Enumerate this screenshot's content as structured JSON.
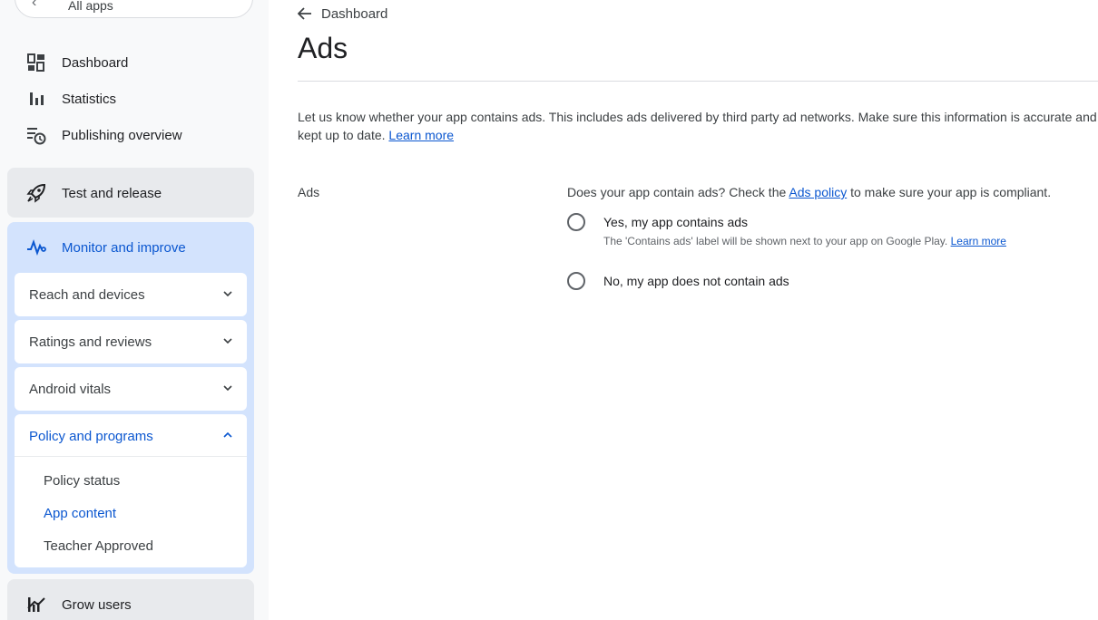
{
  "sidebar": {
    "all_apps_label": "All apps",
    "top_items": [
      {
        "label": "Dashboard",
        "icon": "dashboard-icon"
      },
      {
        "label": "Statistics",
        "icon": "bar-chart-icon"
      },
      {
        "label": "Publishing overview",
        "icon": "publishing-history-icon"
      }
    ],
    "test_release": {
      "label": "Test and release",
      "icon": "rocket-icon"
    },
    "monitor": {
      "label": "Monitor and improve",
      "icon": "monitoring-icon",
      "cards": [
        {
          "label": "Reach and devices"
        },
        {
          "label": "Ratings and reviews"
        },
        {
          "label": "Android vitals"
        },
        {
          "label": "Policy and programs",
          "expanded": true
        }
      ],
      "policy_subitems": [
        {
          "label": "Policy status"
        },
        {
          "label": "App content",
          "active": true
        },
        {
          "label": "Teacher Approved"
        }
      ]
    },
    "grow": {
      "label": "Grow users",
      "icon": "grow-chart-icon"
    }
  },
  "main": {
    "back_label": "Dashboard",
    "title": "Ads",
    "intro_text": "Let us know whether your app contains ads. This includes ads delivered by third party ad networks. Make sure this information is accurate and is kept up to date.",
    "intro_link": "Learn more",
    "field_label": "Ads",
    "question_before": "Does your app contain ads? Check the",
    "question_link": "Ads policy",
    "question_after": "to make sure your app is compliant.",
    "options": [
      {
        "label": "Yes, my app contains ads",
        "help": "The 'Contains ads' label will be shown next to your app on Google Play.",
        "help_link": "Learn more"
      },
      {
        "label": "No, my app does not contain ads"
      }
    ]
  },
  "colors": {
    "accent": "#0b57d0",
    "nav_bg": "#f8f9fa",
    "active_section_bg": "#d3e3fd",
    "section_bg": "#e8eaed"
  }
}
